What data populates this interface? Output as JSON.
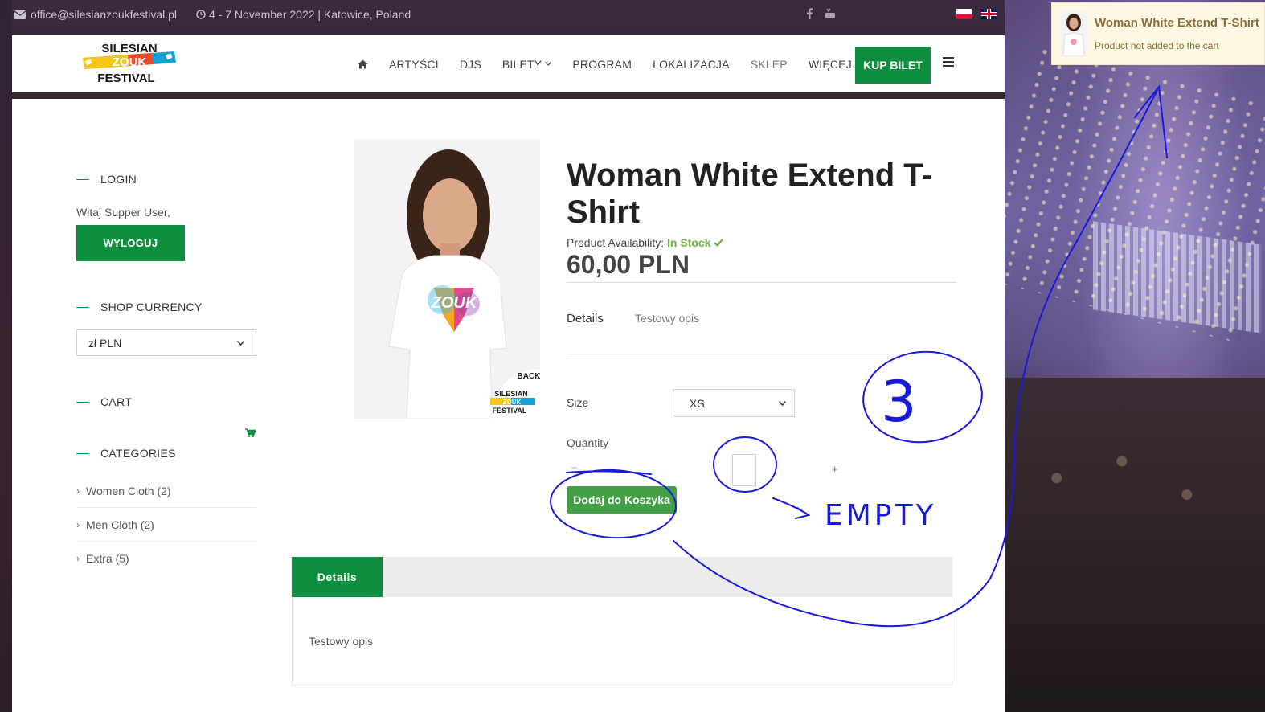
{
  "topbar": {
    "email": "office@silesianzoukfestival.pl",
    "date": "4 - 7 November 2022 | Katowice, Poland"
  },
  "logo": {
    "line1": "SILESIAN",
    "line2": "ZOUK",
    "line3": "FESTIVAL"
  },
  "nav": {
    "items": [
      "ARTYŚCI",
      "DJS",
      "BILETY",
      "PROGRAM",
      "LOKALIZACJA",
      "SKLEP",
      "WIĘCEJ..."
    ],
    "cta": "KUP BILET"
  },
  "sidebar": {
    "login_heading": "LOGIN",
    "welcome": "Witaj Supper User,",
    "logout_label": "WYLOGUJ",
    "currency_heading": "SHOP CURRENCY",
    "currency_value": "zł PLN",
    "cart_heading": "CART",
    "categories_heading": "CATEGORIES",
    "categories": [
      "Women Cloth (2)",
      "Men Cloth (2)",
      "Extra (5)"
    ]
  },
  "product": {
    "image_back_label": "BACK",
    "image_print": "ZOUK",
    "title": "Woman White Extend T-Shirt",
    "availability_label": "Product Availability:",
    "availability_value": "In Stock",
    "price": "60,00 PLN",
    "details_label": "Details",
    "details_value": "Testowy opis",
    "size_label": "Size",
    "size_value": "XS",
    "quantity_label": "Quantity",
    "qty_minus": "–",
    "qty_plus": "+",
    "add_to_cart": "Dodaj do Koszyka"
  },
  "tabs": {
    "active_label": "Details",
    "panel_text": "Testowy opis"
  },
  "toast": {
    "title": "Woman White Extend T-Shirt",
    "message": "Product not added to the cart"
  },
  "annotations": {
    "number": "3",
    "note": "EMPTY",
    "ink_color": "#1a1adb"
  },
  "colors": {
    "brand_green": "#0e8f3f",
    "button_green": "#43a047",
    "in_stock": "#6ab23a",
    "toast_bg": "#fcf8e3",
    "toast_text": "#8a6d3b"
  }
}
